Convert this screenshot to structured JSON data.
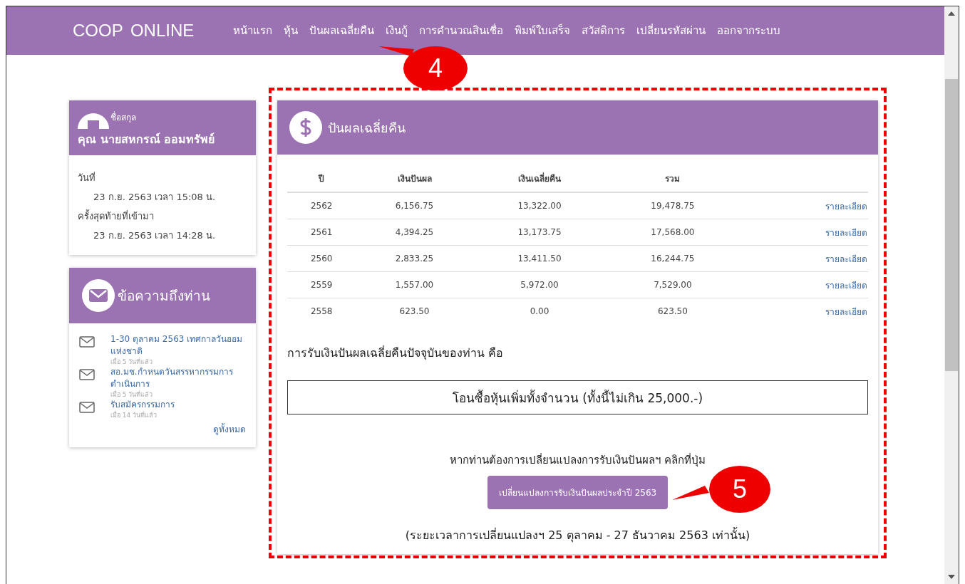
{
  "navbar": {
    "brand": "COOP ONLINE",
    "items": [
      {
        "label": "หน้าแรก"
      },
      {
        "label": "หุ้น"
      },
      {
        "label": "ปันผลเฉลี่ยคืน"
      },
      {
        "label": "เงินกู้"
      },
      {
        "label": "การคำนวณสินเชื่อ"
      },
      {
        "label": "พิมพ์ใบเสร็จ"
      },
      {
        "label": "สวัสดิการ"
      },
      {
        "label": "เปลี่ยนรหัสผ่าน"
      },
      {
        "label": "ออกจากระบบ"
      }
    ]
  },
  "profile": {
    "label": "ชื่อสกุล",
    "name": "คุณ นายสหกรณ์  ออมทรัพย์",
    "lines": [
      {
        "kind": "label",
        "text": "วันที่"
      },
      {
        "kind": "value",
        "text": "23 ก.ย. 2563 เวลา 15:08 น."
      },
      {
        "kind": "label",
        "text": "ครั้งสุดท้ายที่เข้ามา"
      },
      {
        "kind": "value",
        "text": "23 ก.ย. 2563 เวลา 14:28 น."
      }
    ]
  },
  "messages": {
    "title": "ข้อความถึงท่าน",
    "items": [
      {
        "title": "1-30 ตุลาคม 2563 เทศกาลวันออมแห่งชาติ",
        "time": "เมื่อ 5 วันที่แล้ว"
      },
      {
        "title": "สอ.มช.กำหนดวันสรรหากรรมการดำเนินการ",
        "time": "เมื่อ 5 วันที่แล้ว"
      },
      {
        "title": "รับสมัครกรรมการ",
        "time": "เมื่อ 14 วันที่แล้ว"
      }
    ],
    "see_all": "ดูทั้งหมด"
  },
  "dividend": {
    "title": "ปันผลเฉลี่ยคืน",
    "columns": [
      "ปี",
      "เงินปันผล",
      "เงินเฉลี่ยคืน",
      "รวม"
    ],
    "rows": [
      {
        "cells": [
          "2562",
          "6,156.75",
          "13,322.00",
          "19,478.75"
        ],
        "link": "รายละเอียด"
      },
      {
        "cells": [
          "2561",
          "4,394.25",
          "13,173.75",
          "17,568.00"
        ],
        "link": "รายละเอียด"
      },
      {
        "cells": [
          "2560",
          "2,833.25",
          "13,411.50",
          "16,244.75"
        ],
        "link": "รายละเอียด"
      },
      {
        "cells": [
          "2559",
          "1,557.00",
          "5,972.00",
          "7,529.00"
        ],
        "link": "รายละเอียด"
      },
      {
        "cells": [
          "2558",
          "623.50",
          "0.00",
          "623.50"
        ],
        "link": "รายละเอียด"
      }
    ],
    "current_label": "การรับเงินปันผลเฉลี่ยคืนปัจจุบันของท่าน คือ",
    "current_value": "โอนซื้อหุ้นเพิ่มทั้งจำนวน (ทั้งนี้ไม่เกิน 25,000.-)",
    "change_prompt": "หากท่านต้องการเปลี่ยนแปลงการรับเงินปันผลฯ คลิกที่ปุ่ม",
    "change_button": "เปลี่ยนแปลงการรับเงินปันผลประจำปี 2563",
    "period_note": "(ระยะเวลาการเปลี่ยนแปลงฯ 25 ตุลาคม - 27 ธันวาคม 2563 เท่านั้น)"
  },
  "annotations": [
    {
      "label": "4"
    },
    {
      "label": "5"
    }
  ]
}
